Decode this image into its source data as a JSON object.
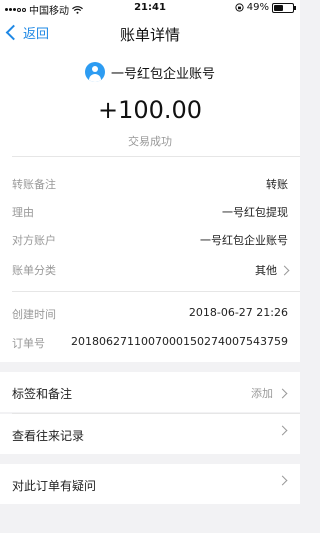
{
  "status_bar": {
    "carrier": "中国移动",
    "time": "21:41",
    "battery": "49%"
  },
  "nav": {
    "back_label": "返回",
    "title": "账单详情"
  },
  "header": {
    "payee": "一号红包企业账号",
    "amount": "+100.00",
    "status": "交易成功"
  },
  "details": {
    "rows": [
      {
        "label": "转账备注",
        "value": "转账"
      },
      {
        "label": "理由",
        "value": "一号红包提现"
      },
      {
        "label": "对方账户",
        "value": "一号红包企业账号"
      },
      {
        "label": "账单分类",
        "value": "其他"
      },
      {
        "label": "创建时间",
        "value": "2018-06-27 21:26"
      },
      {
        "label": "订单号",
        "value": "2018062711007000150274007543759"
      }
    ]
  },
  "actions": {
    "tags_label": "标签和备注",
    "tags_action": "添加",
    "history_label": "查看往来记录",
    "question_label": "对此订单有疑问"
  }
}
